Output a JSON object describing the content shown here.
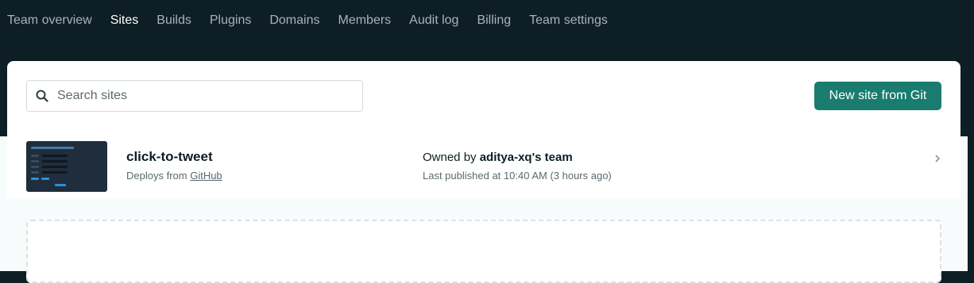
{
  "nav": {
    "items": [
      {
        "label": "Team overview",
        "active": false
      },
      {
        "label": "Sites",
        "active": true
      },
      {
        "label": "Builds",
        "active": false
      },
      {
        "label": "Plugins",
        "active": false
      },
      {
        "label": "Domains",
        "active": false
      },
      {
        "label": "Members",
        "active": false
      },
      {
        "label": "Audit log",
        "active": false
      },
      {
        "label": "Billing",
        "active": false
      },
      {
        "label": "Team settings",
        "active": false
      }
    ]
  },
  "search": {
    "placeholder": "Search sites",
    "value": "",
    "icon": "search-icon"
  },
  "toolbar": {
    "new_site_label": "New site from Git"
  },
  "sites": [
    {
      "name": "click-to-tweet",
      "deploys_prefix": "Deploys from",
      "deploys_source": "GitHub",
      "owned_prefix": "Owned by",
      "owner": "aditya-xq's team",
      "published": "Last published at 10:40 AM (3 hours ago)"
    }
  ],
  "colors": {
    "header_bg": "#0e1e25",
    "nav_text": "#a8b3b8",
    "nav_active": "#ffffff",
    "accent": "#1a7c6f",
    "panel_bg": "#ffffff"
  }
}
